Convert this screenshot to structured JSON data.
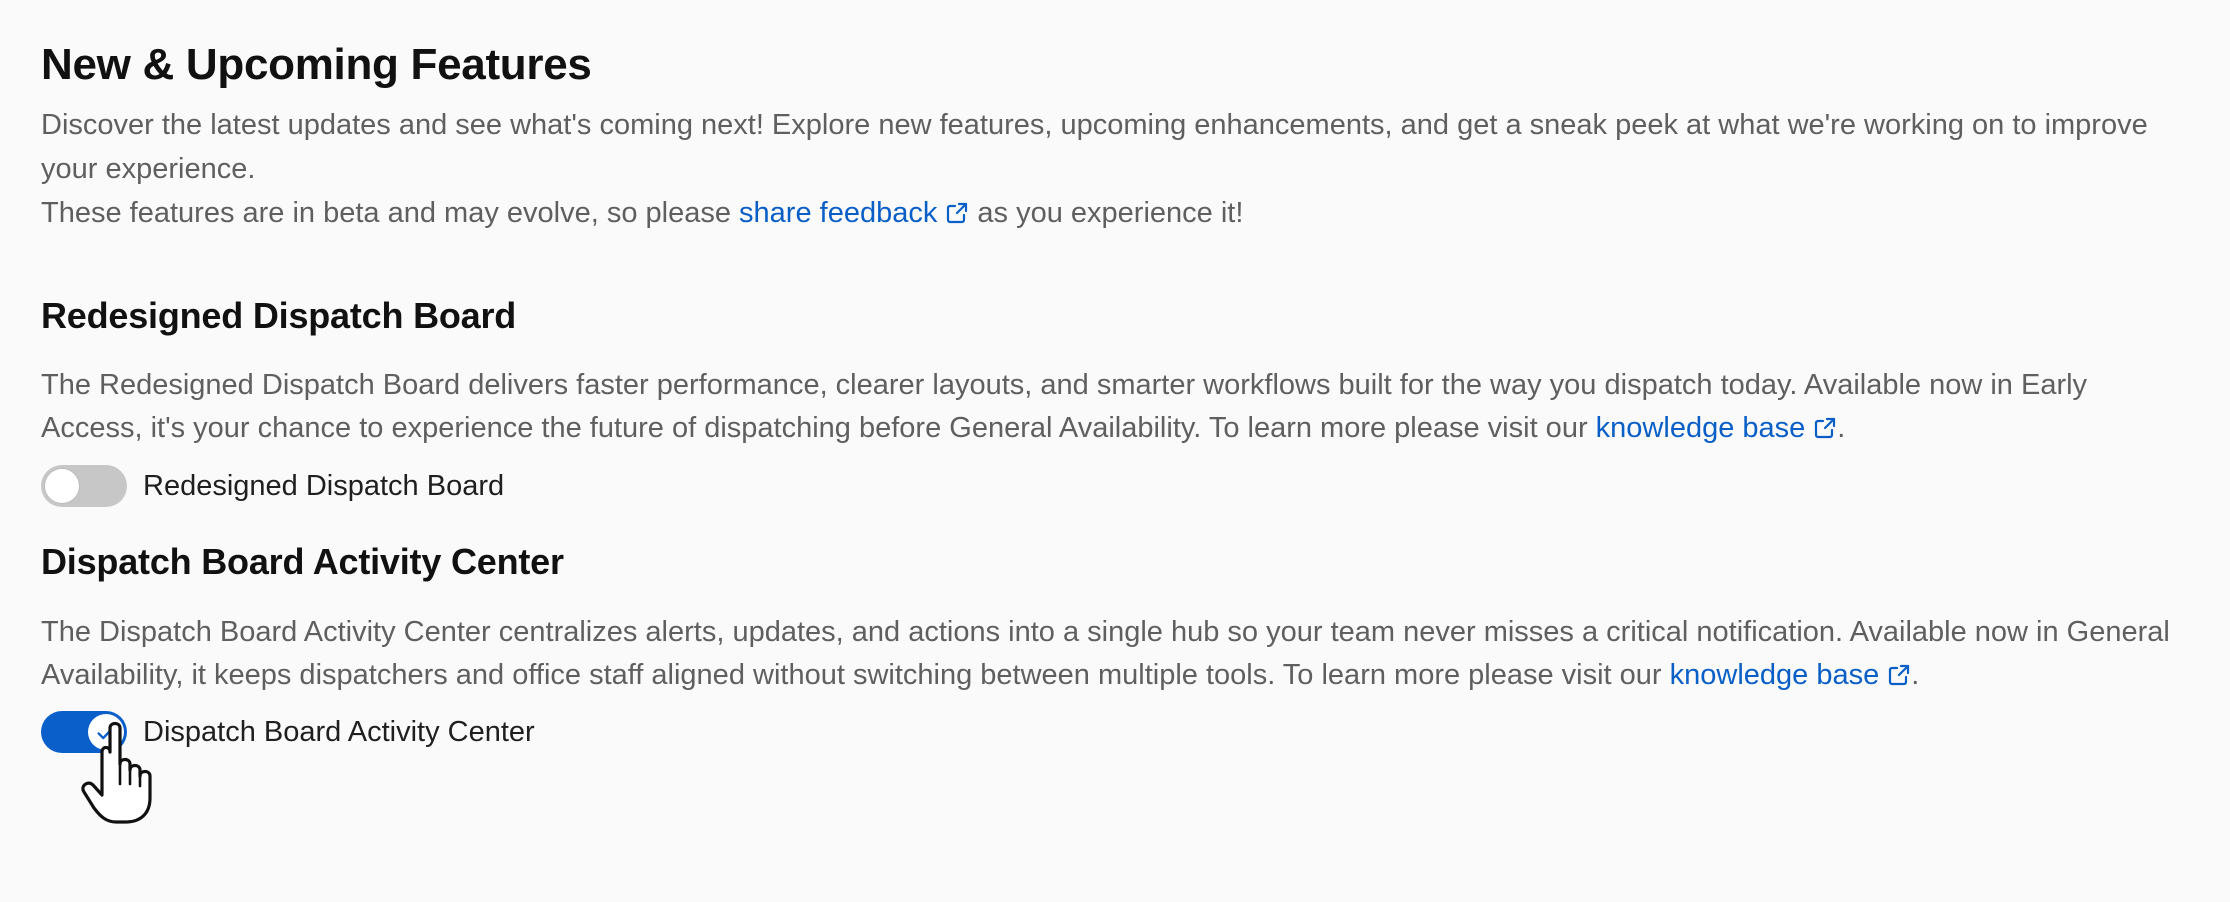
{
  "page": {
    "title": "New & Upcoming Features"
  },
  "intro": {
    "line1": "Discover the latest updates and see what's coming next! Explore new features, upcoming enhancements, and get a sneak peek at what we're working on to improve your experience.",
    "line2_before": "These features are in beta and may evolve, so please ",
    "feedback_link": "share feedback",
    "line2_after": " as you experience it!"
  },
  "features": [
    {
      "title": "Redesigned Dispatch Board",
      "description_before": "The Redesigned Dispatch Board delivers faster performance, clearer layouts, and smarter workflows built for the way you dispatch today. Available now in Early Access, it's your chance to experience the future of dispatching before General Availability. To learn more please visit our ",
      "link": "knowledge base",
      "description_after": ".",
      "toggle_label": "Redesigned Dispatch Board",
      "enabled": false
    },
    {
      "title": "Dispatch Board Activity Center",
      "description_before": "The Dispatch Board Activity Center centralizes alerts, updates, and actions into a single hub so your team never misses a critical notification. Available now in General Availability, it keeps dispatchers and office staff aligned without switching between multiple tools. To learn more please visit our ",
      "link": "knowledge base",
      "description_after": ".",
      "toggle_label": "Dispatch Board Activity Center",
      "enabled": true
    }
  ],
  "icons": {
    "external_link": "external-link-icon",
    "check": "check-icon",
    "cursor": "hand-pointer-icon"
  },
  "colors": {
    "link": "#0a5fc7",
    "toggle_on": "#0b5fca",
    "toggle_off": "#c7c7c7"
  }
}
